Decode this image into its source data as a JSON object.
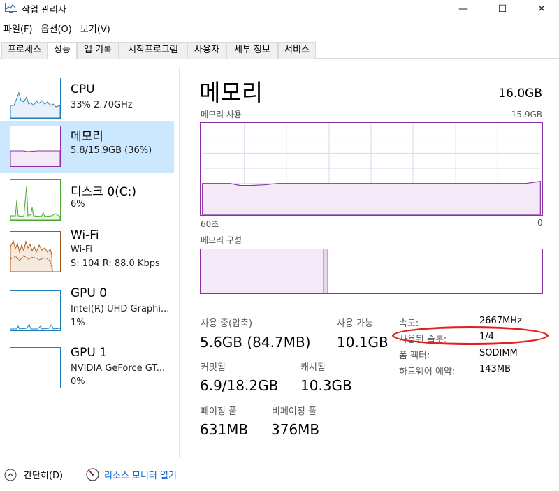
{
  "window": {
    "title": "작업 관리자",
    "minimize": "—",
    "maximize": "☐",
    "close": "✕"
  },
  "menu": [
    "파일(F)",
    "옵션(O)",
    "보기(V)"
  ],
  "tabs": [
    "프로세스",
    "성능",
    "앱 기록",
    "시작프로그램",
    "사용자",
    "세부 정보",
    "서비스"
  ],
  "active_tab": "성능",
  "sidebar": {
    "items": [
      {
        "title": "CPU",
        "sub1": "33% 2.70GHz",
        "sub2": "",
        "color": "#1e7dbd"
      },
      {
        "title": "메모리",
        "sub1": "5.8/15.9GB (36%)",
        "sub2": "",
        "color": "#8b2fa8"
      },
      {
        "title": "디스크 0(C:)",
        "sub1": "6%",
        "sub2": "",
        "color": "#4ca630"
      },
      {
        "title": "Wi-Fi",
        "sub1": "Wi-Fi",
        "sub2": "S: 104 R: 88.0 Kbps",
        "color": "#a6581e"
      },
      {
        "title": "GPU 0",
        "sub1": "Intel(R) UHD Graphi...",
        "sub2": "1%",
        "color": "#1e7dbd"
      },
      {
        "title": "GPU 1",
        "sub1": "NVIDIA GeForce GT...",
        "sub2": "0%",
        "color": "#1e7dbd"
      }
    ]
  },
  "main": {
    "title": "메모리",
    "total": "16.0GB",
    "usage_graph_label": "메모리 사용",
    "usage_graph_max": "15.9GB",
    "axis_left": "60초",
    "axis_right": "0",
    "composition_label": "메모리 구성",
    "stats": {
      "in_use_label": "사용 중(압축)",
      "in_use_value": "5.6GB (84.7MB)",
      "available_label": "사용 가능",
      "available_value": "10.1GB",
      "committed_label": "커밋됨",
      "committed_value": "6.9/18.2GB",
      "cached_label": "캐시됨",
      "cached_value": "10.3GB",
      "paged_label": "페이징 풀",
      "paged_value": "631MB",
      "nonpaged_label": "비페이징 풀",
      "nonpaged_value": "376MB"
    },
    "details": [
      {
        "label": "속도:",
        "value": "2667MHz"
      },
      {
        "label": "사용된 슬롯:",
        "value": "1/4"
      },
      {
        "label": "폼 팩터:",
        "value": "SODIMM"
      },
      {
        "label": "하드웨어 예약:",
        "value": "143MB"
      }
    ],
    "memory_used_fraction": 0.36
  },
  "footer": {
    "simple_label": "간단히(D)",
    "resmon_label": "리소스 모니터 열기"
  },
  "colors": {
    "memory_accent": "#8b2fa8",
    "selection": "#cce8ff",
    "highlight": "#e41f1f",
    "link": "#0066cc"
  }
}
